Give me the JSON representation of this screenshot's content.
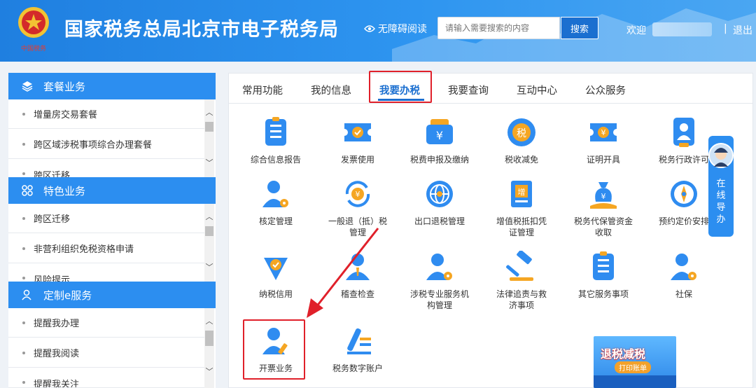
{
  "header": {
    "title": "国家税务总局北京市电子税务局",
    "emblem_caption": "中国税务",
    "accessibility": "无障碍阅读",
    "search_placeholder": "请输入需要搜索的内容",
    "search_button": "搜索",
    "welcome": "欢迎",
    "separator": "|",
    "logout": "退出"
  },
  "sidebar": {
    "sections": [
      {
        "title": "套餐业务",
        "icon": "layers-icon",
        "items": [
          "增量房交易套餐",
          "跨区域涉税事项综合办理套餐",
          "跨区迁移"
        ]
      },
      {
        "title": "特色业务",
        "icon": "grid-icon",
        "items": [
          "跨区迁移",
          "非营利组织免税资格申请",
          "风险提示"
        ]
      },
      {
        "title": "定制e服务",
        "icon": "user-icon",
        "items": [
          "提醒我办理",
          "提醒我阅读",
          "提醒我关注"
        ]
      }
    ]
  },
  "tabs": [
    {
      "label": "常用功能",
      "active": false
    },
    {
      "label": "我的信息",
      "active": false
    },
    {
      "label": "我要办税",
      "active": true
    },
    {
      "label": "我要查询",
      "active": false
    },
    {
      "label": "互动中心",
      "active": false
    },
    {
      "label": "公众服务",
      "active": false
    }
  ],
  "functions": [
    {
      "label": "综合信息报告",
      "icon": "report-icon"
    },
    {
      "label": "发票使用",
      "icon": "invoice-icon"
    },
    {
      "label": "税费申报及缴纳",
      "icon": "wallet-yuan-icon"
    },
    {
      "label": "税收减免",
      "icon": "tax-reduce-icon"
    },
    {
      "label": "证明开具",
      "icon": "certificate-icon"
    },
    {
      "label": "税务行政许可",
      "icon": "admin-permit-icon"
    },
    {
      "label": "核定管理",
      "icon": "user-gear-icon"
    },
    {
      "label": "一般退（抵）税管理",
      "icon": "refund-icon"
    },
    {
      "label": "出口退税管理",
      "icon": "globe-icon"
    },
    {
      "label": "增值税抵扣凭证管理",
      "icon": "vat-voucher-icon"
    },
    {
      "label": "税务代保管资金收取",
      "icon": "money-bag-icon"
    },
    {
      "label": "预约定价安排",
      "icon": "compass-icon"
    },
    {
      "label": "纳税信用",
      "icon": "credit-icon"
    },
    {
      "label": "稽查检查",
      "icon": "inspector-icon"
    },
    {
      "label": "涉税专业服务机构管理",
      "icon": "agency-icon"
    },
    {
      "label": "法律追责与救济事项",
      "icon": "gavel-icon"
    },
    {
      "label": "其它服务事项",
      "icon": "document-list-icon"
    },
    {
      "label": "社保",
      "icon": "social-security-icon"
    },
    {
      "label": "开票业务",
      "icon": "user-pen-icon"
    },
    {
      "label": "税务数字账户",
      "icon": "digital-account-icon"
    }
  ],
  "guide": {
    "label": "在线导办"
  },
  "banner": {
    "title": "退税减税",
    "subtitle": "打印账单"
  },
  "colors": {
    "primary": "#2c8ef0",
    "active_tab": "#1b6fd0",
    "highlight": "#e0202a",
    "icon_blue": "#2f8cf0",
    "icon_orange": "#f5a623"
  }
}
